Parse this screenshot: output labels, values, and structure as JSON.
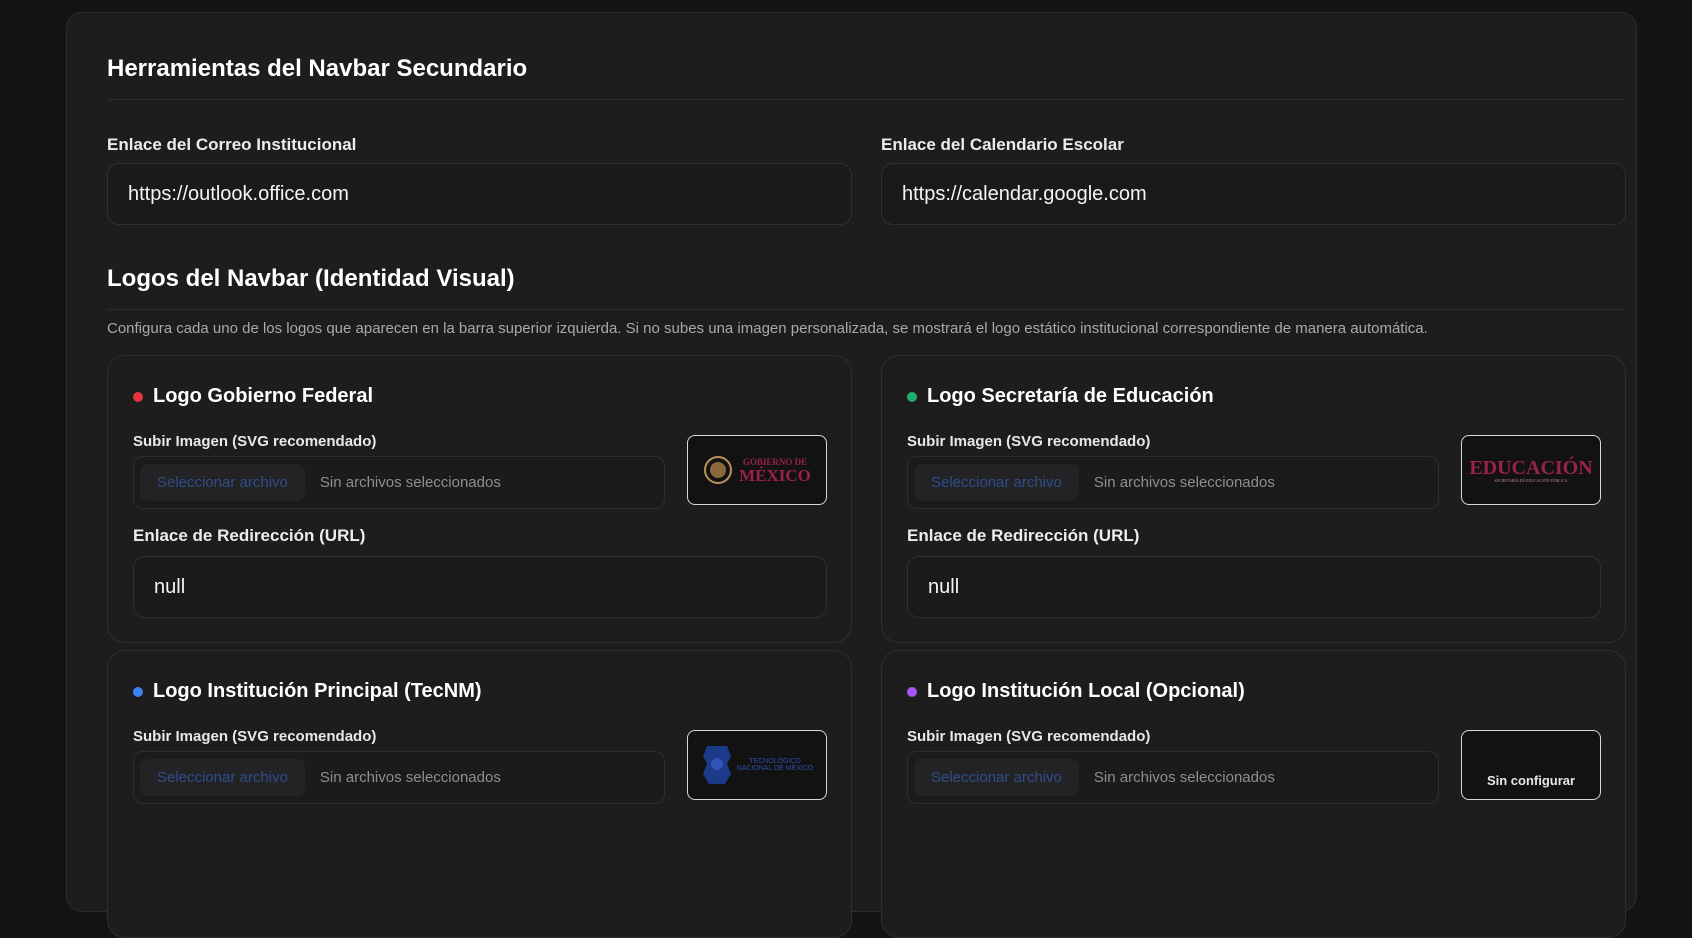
{
  "toolbar_section": {
    "title": "Herramientas del Navbar Secundario",
    "mail_label": "Enlace del Correo Institucional",
    "mail_value": "https://outlook.office.com",
    "calendar_label": "Enlace del Calendario Escolar",
    "calendar_value": "https://calendar.google.com"
  },
  "logos_section": {
    "title": "Logos del Navbar (Identidad Visual)",
    "description": "Configura cada uno de los logos que aparecen en la barra superior izquierda. Si no subes una imagen personalizada, se mostrará el logo estático institucional correspondiente de manera automática."
  },
  "cards": [
    {
      "title": "Logo Gobierno Federal",
      "dot_color": "#e5343f",
      "upload_label": "Subir Imagen (SVG recomendado)",
      "file_button": "Seleccionar archivo",
      "file_status": "Sin archivos seleccionados",
      "preview_line1": "GOBIERNO DE",
      "preview_line2": "MÉXICO",
      "redirect_label": "Enlace de Redirección (URL)",
      "redirect_value": "null"
    },
    {
      "title": "Logo Secretaría de Educación",
      "dot_color": "#1fae6d",
      "upload_label": "Subir Imagen (SVG recomendado)",
      "file_button": "Seleccionar archivo",
      "file_status": "Sin archivos seleccionados",
      "preview_line1": "EDUCACIÓN",
      "preview_line2": "SECRETARÍA DE EDUCACIÓN PÚBLICA",
      "redirect_label": "Enlace de Redirección (URL)",
      "redirect_value": "null"
    },
    {
      "title": "Logo Institución Principal (TecNM)",
      "dot_color": "#3b82f6",
      "upload_label": "Subir Imagen (SVG recomendado)",
      "file_button": "Seleccionar archivo",
      "file_status": "Sin archivos seleccionados",
      "preview_line1": "TECNOLÓGICO",
      "preview_line2": "NACIONAL DE MÉXICO"
    },
    {
      "title": "Logo Institución Local (Opcional)",
      "dot_color": "#a855f7",
      "upload_label": "Subir Imagen (SVG recomendado)",
      "file_button": "Seleccionar archivo",
      "file_status": "Sin archivos seleccionados",
      "preview_empty": "Sin configurar"
    }
  ]
}
